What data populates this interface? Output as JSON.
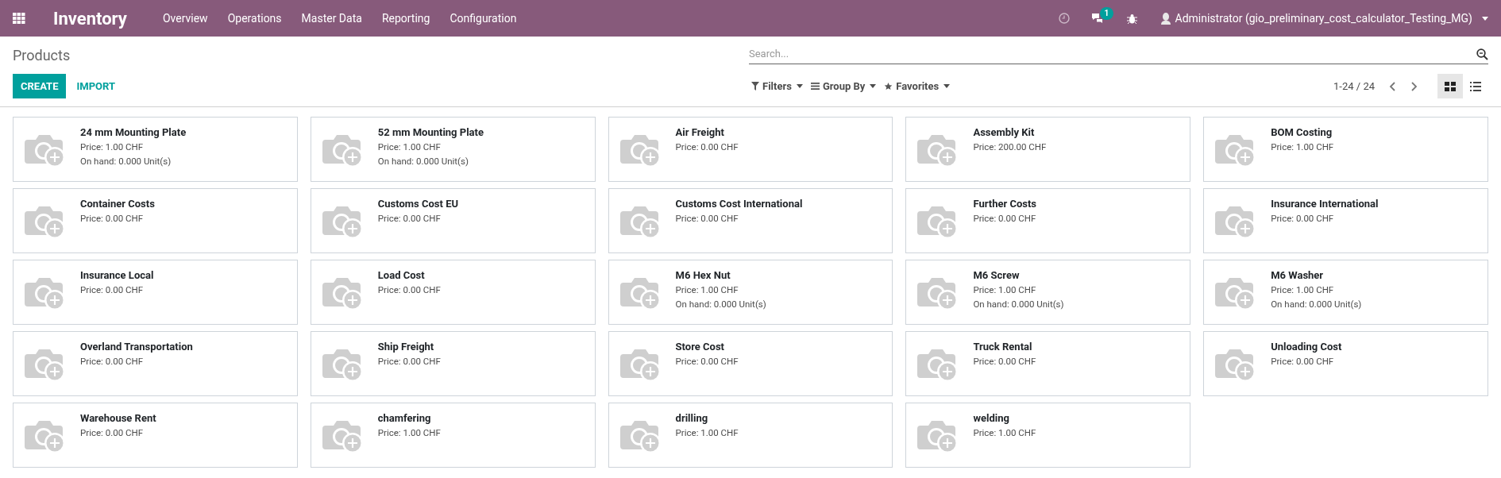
{
  "navbar": {
    "app_title": "Inventory",
    "menu": [
      "Overview",
      "Operations",
      "Master Data",
      "Reporting",
      "Configuration"
    ],
    "messages_count": "1",
    "user": "Administrator (gio_preliminary_cost_calculator_Testing_MG)"
  },
  "control_panel": {
    "title": "Products",
    "create": "CREATE",
    "import": "IMPORT",
    "search": {
      "placeholder": "Search..."
    },
    "filters": [
      "Filters",
      "Group By",
      "Favorites"
    ],
    "pager": "1-24 / 24",
    "views": [
      {
        "kind": "kanban",
        "selected": true
      },
      {
        "kind": "list",
        "selected": false
      }
    ]
  },
  "products": [
    {
      "name": "24 mm Mounting Plate",
      "price": "Price: 1.00 CHF",
      "on_hand": "On hand: 0.000 Unit(s)"
    },
    {
      "name": "52 mm Mounting Plate",
      "price": "Price: 1.00 CHF",
      "on_hand": "On hand: 0.000 Unit(s)"
    },
    {
      "name": "Air Freight",
      "price": "Price: 0.00 CHF"
    },
    {
      "name": "Assembly Kit",
      "price": "Price: 200.00 CHF"
    },
    {
      "name": "BOM Costing",
      "price": "Price: 1.00 CHF"
    },
    {
      "name": "Container Costs",
      "price": "Price: 0.00 CHF"
    },
    {
      "name": "Customs Cost EU",
      "price": "Price: 0.00 CHF"
    },
    {
      "name": "Customs Cost International",
      "price": "Price: 0.00 CHF"
    },
    {
      "name": "Further Costs",
      "price": "Price: 0.00 CHF"
    },
    {
      "name": "Insurance International",
      "price": "Price: 0.00 CHF"
    },
    {
      "name": "Insurance Local",
      "price": "Price: 0.00 CHF"
    },
    {
      "name": "Load Cost",
      "price": "Price: 0.00 CHF"
    },
    {
      "name": "M6 Hex Nut",
      "price": "Price: 1.00 CHF",
      "on_hand": "On hand: 0.000 Unit(s)"
    },
    {
      "name": "M6 Screw",
      "price": "Price: 1.00 CHF",
      "on_hand": "On hand: 0.000 Unit(s)"
    },
    {
      "name": "M6 Washer",
      "price": "Price: 1.00 CHF",
      "on_hand": "On hand: 0.000 Unit(s)"
    },
    {
      "name": "Overland Transportation",
      "price": "Price: 0.00 CHF"
    },
    {
      "name": "Ship Freight",
      "price": "Price: 0.00 CHF"
    },
    {
      "name": "Store Cost",
      "price": "Price: 0.00 CHF"
    },
    {
      "name": "Truck Rental",
      "price": "Price: 0.00 CHF"
    },
    {
      "name": "Unloading Cost",
      "price": "Price: 0.00 CHF"
    },
    {
      "name": "Warehouse Rent",
      "price": "Price: 0.00 CHF"
    },
    {
      "name": "chamfering",
      "price": "Price: 1.00 CHF"
    },
    {
      "name": "drilling",
      "price": "Price: 1.00 CHF"
    },
    {
      "name": "welding",
      "price": "Price: 1.00 CHF"
    }
  ]
}
